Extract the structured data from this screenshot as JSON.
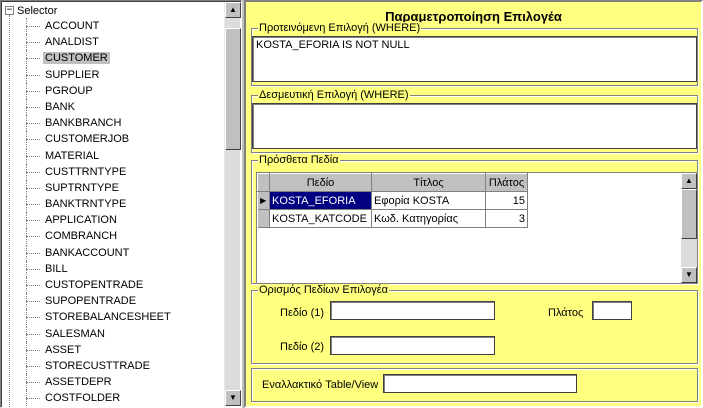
{
  "tree": {
    "root_label": "Selector",
    "expander_symbol": "−",
    "selected_index": 2,
    "items": [
      "ACCOUNT",
      "ANALDIST",
      "CUSTOMER",
      "SUPPLIER",
      "PGROUP",
      "BANK",
      "BANKBRANCH",
      "CUSTOMERJOB",
      "MATERIAL",
      "CUSTTRNTYPE",
      "SUPTRNTYPE",
      "BANKTRNTYPE",
      "APPLICATION",
      "COMBRANCH",
      "BANKACCOUNT",
      "BILL",
      "CUSTOPENTRADE",
      "SUPOPENTRADE",
      "STOREBALANCESHEET",
      "SALESMAN",
      "ASSET",
      "STORECUSTTRADE",
      "ASSETDEPR",
      "COSTFOLDER"
    ],
    "scroll_up_symbol": "▲",
    "scroll_down_symbol": "▼"
  },
  "form": {
    "title": "Παραμετροποίηση Επιλογέα",
    "suggested": {
      "legend": "Προτεινόμενη Επιλογή (WHERE)",
      "value": "KOSTA_EFORIA IS NOT NULL"
    },
    "mandatory": {
      "legend": "Δεσμευτική Επιλογή (WHERE)",
      "value": ""
    },
    "extra_fields": {
      "legend": "Πρόσθετα Πεδία",
      "columns": [
        "Πεδίο",
        "Τίτλος",
        "Πλάτος"
      ],
      "current_row_symbol": "▶",
      "rows": [
        {
          "field": "KOSTA_EFORIA",
          "title": "Εφορία KOSTA",
          "width": "15"
        },
        {
          "field": "KOSTA_KATCODE",
          "title": "Κωδ. Κατηγορίας",
          "width": "3"
        }
      ]
    },
    "selector_fields": {
      "legend": "Ορισμός Πεδίων Επιλογέα",
      "field1_label": "Πεδίο (1)",
      "field1_value": "",
      "width_label": "Πλάτος",
      "width_value": "",
      "field2_label": "Πεδίο (2)",
      "field2_value": ""
    },
    "alt_table": {
      "label": "Εναλλακτικό Table/View",
      "value": ""
    }
  },
  "colors": {
    "form_background": "#ffff80",
    "selection": "#000080",
    "tree_selection": "#c0c0c0"
  }
}
